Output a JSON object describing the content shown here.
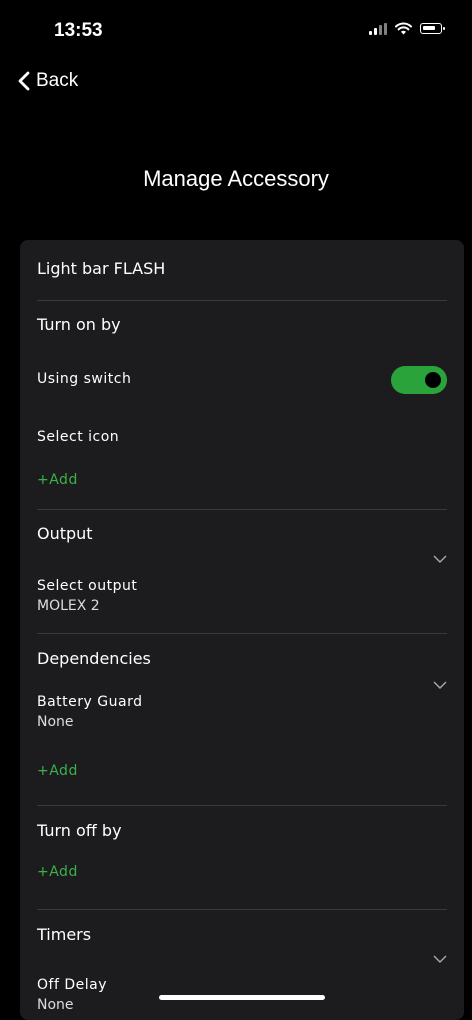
{
  "status_bar": {
    "time": "13:53"
  },
  "nav": {
    "back_label": "Back",
    "title": "Manage Accessory"
  },
  "accessory": {
    "name": "Light bar FLASH",
    "turn_on_by": {
      "heading": "Turn on by",
      "switch_label": "Using switch",
      "switch_on": true,
      "select_icon_label": "Select icon",
      "add_label": "+Add"
    },
    "output": {
      "heading": "Output",
      "select_label": "Select output",
      "value": "MOLEX 2"
    },
    "dependencies": {
      "heading": "Dependencies",
      "battery_guard_label": "Battery Guard",
      "battery_guard_value": "None",
      "add_label": "+Add"
    },
    "turn_off_by": {
      "heading": "Turn off by",
      "add_label": "+Add"
    },
    "timers": {
      "heading": "Timers",
      "off_delay_label": "Off Delay",
      "off_delay_value": "None"
    }
  },
  "colors": {
    "accent": "#2aa33a",
    "card": "#1c1c1e",
    "background": "#000000"
  }
}
